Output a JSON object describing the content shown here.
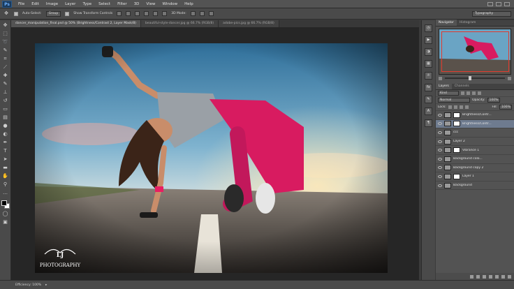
{
  "app": {
    "logo": "Ps"
  },
  "menu": [
    "File",
    "Edit",
    "Image",
    "Layer",
    "Type",
    "Select",
    "Filter",
    "3D",
    "View",
    "Window",
    "Help"
  ],
  "options": {
    "auto_select_label": "Auto-Select:",
    "auto_select_value": "Group",
    "transform_label": "Show Transform Controls",
    "mode_label": "3D Mode:",
    "workspace": "Typography"
  },
  "tabs": [
    {
      "title": "dancer_manipulation_final.psd @ 50% (Brightness/Contrast 2, Layer Mask/8)",
      "active": true
    },
    {
      "title": "beautiful-style-dancer.jpg @ 66.7% (RGB/8)",
      "active": false
    },
    {
      "title": "adobe-pics.jpg @ 66.7% (RGB/8)",
      "active": false
    }
  ],
  "watermark": {
    "initials": "LJ",
    "text": "PHOTOGRAPHY"
  },
  "panels": {
    "top_tabs": [
      "Navigator",
      "Histogram"
    ],
    "layers_tabs": [
      "Layers",
      "Channels"
    ],
    "kind_label": "Kind",
    "blend_mode": "Normal",
    "opacity_label": "Opacity:",
    "opacity_value": "100%",
    "lock_label": "Lock:",
    "fill_label": "Fill:",
    "fill_value": "100%",
    "layers": [
      {
        "name": "Brightness/Contr...",
        "selected": false,
        "mask": true
      },
      {
        "name": "Brightness/Contr...",
        "selected": true,
        "mask": true
      },
      {
        "name": "ccc",
        "selected": false,
        "mask": false
      },
      {
        "name": "Layer 2",
        "selected": false,
        "mask": false
      },
      {
        "name": "Vibrance 1",
        "selected": false,
        "mask": true
      },
      {
        "name": "Background colo...",
        "selected": false,
        "mask": false
      },
      {
        "name": "Background copy 2",
        "selected": false,
        "mask": false
      },
      {
        "name": "Layer 1",
        "selected": false,
        "mask": true
      },
      {
        "name": "Background",
        "selected": false,
        "mask": false
      }
    ]
  },
  "status": {
    "text": "Efficiency: 100%"
  },
  "colors": {
    "accent_red": "#e23b2e",
    "selected_layer": "#6e7b8f"
  }
}
